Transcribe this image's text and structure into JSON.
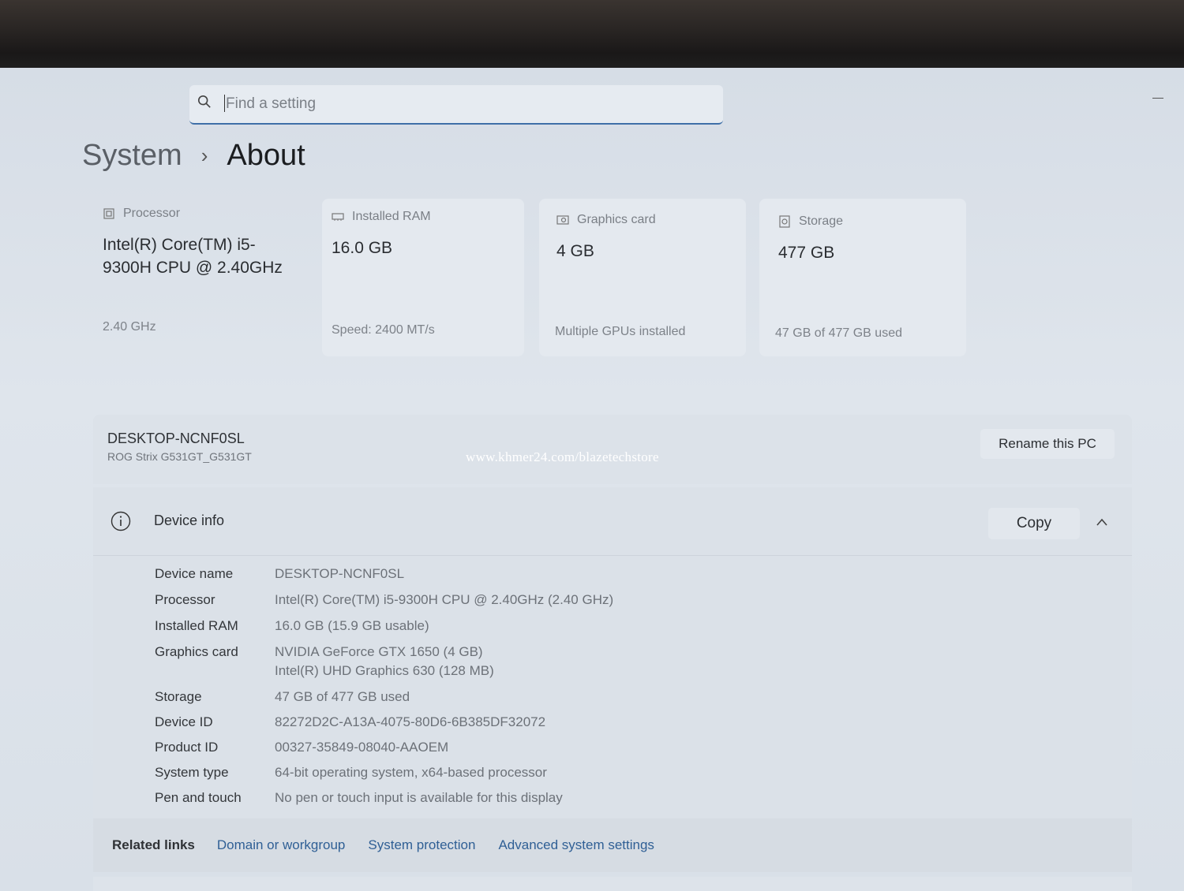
{
  "search": {
    "placeholder": "Find a setting"
  },
  "breadcrumb": {
    "parent": "System",
    "separator": "›",
    "current": "About"
  },
  "cards": [
    {
      "icon": "processor-icon",
      "label": "Processor",
      "value": "Intel(R) Core(TM) i5-9300H CPU @ 2.40GHz",
      "sub": "2.40 GHz"
    },
    {
      "icon": "ram-icon",
      "label": "Installed RAM",
      "value": "16.0 GB",
      "sub": "Speed: 2400 MT/s"
    },
    {
      "icon": "graphics-card-icon",
      "label": "Graphics card",
      "value": "4 GB",
      "sub": "Multiple GPUs installed"
    },
    {
      "icon": "storage-icon",
      "label": "Storage",
      "value": "477 GB",
      "sub": "47 GB of 477 GB used"
    }
  ],
  "pc": {
    "name": "DESKTOP-NCNF0SL",
    "model": "ROG Strix G531GT_G531GT",
    "rename_label": "Rename this PC",
    "watermark": "www.khmer24.com/blazetechstore"
  },
  "device_info": {
    "title": "Device info",
    "copy_label": "Copy",
    "specs": [
      {
        "label": "Device name",
        "value": "DESKTOP-NCNF0SL"
      },
      {
        "label": "Processor",
        "value": "Intel(R) Core(TM) i5-9300H CPU @ 2.40GHz (2.40 GHz)"
      },
      {
        "label": "Installed RAM",
        "value": "16.0 GB (15.9 GB usable)"
      },
      {
        "label": "Graphics card",
        "value": "NVIDIA GeForce GTX 1650 (4 GB)",
        "value2": "Intel(R) UHD Graphics 630 (128 MB)"
      },
      {
        "label": "Storage",
        "value": "47 GB of 477 GB used"
      },
      {
        "label": "Device ID",
        "value": "82272D2C-A13A-4075-80D6-6B385DF32072"
      },
      {
        "label": "Product ID",
        "value": "00327-35849-08040-AAOEM"
      },
      {
        "label": "System type",
        "value": "64-bit operating system, x64-based processor"
      },
      {
        "label": "Pen and touch",
        "value": "No pen or touch input is available for this display"
      }
    ]
  },
  "related": {
    "label": "Related links",
    "links": [
      "Domain or workgroup",
      "System protection",
      "Advanced system settings"
    ]
  }
}
